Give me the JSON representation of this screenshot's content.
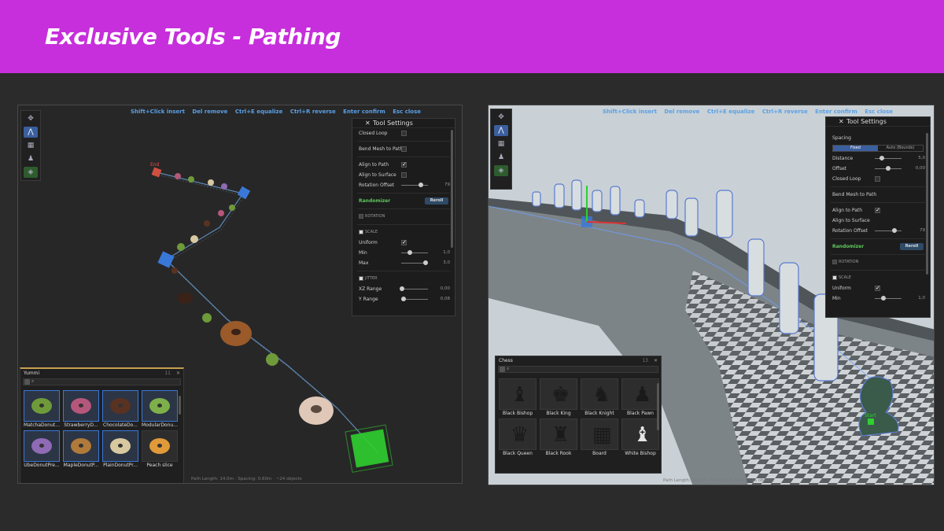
{
  "slide": {
    "title": "Exclusive Tools - Pathing"
  },
  "hotkeys": [
    "Shift+Click insert",
    "Del remove",
    "Ctrl+E equalize",
    "Ctrl+R reverse",
    "Enter confirm",
    "Esc close"
  ],
  "tool_icons": [
    "move-icon",
    "path-node-icon",
    "grid-icon",
    "stamp-icon",
    "scatter-icon"
  ],
  "left": {
    "viewport_labels": {
      "end": "End"
    },
    "settings": {
      "title": "Tool Settings",
      "closed_loop": "Closed Loop",
      "bend_mesh": "Bend Mesh to Path",
      "align_to_path": "Align to Path",
      "align_to_surface": "Align to Surface",
      "rotation_offset": "Rotation Offset",
      "rotation_offset_value": "79",
      "randomizer": "Randomizer",
      "reroll": "Reroll",
      "rotation_section": "ROTATION",
      "scale_section": "SCALE",
      "uniform": "Uniform",
      "min": "Min",
      "min_value": "1,0",
      "max": "Max",
      "max_value": "3,0",
      "jitter_section": "JITTER",
      "xz_range": "XZ Range",
      "xz_range_value": "0,00",
      "y_range": "Y Range",
      "y_range_value": "0,08"
    },
    "browser": {
      "title": "Yummi",
      "count": "11",
      "items": [
        {
          "label": "MatchaDonut...",
          "color": "#6f9a3a",
          "selected": true
        },
        {
          "label": "StrawberryD...",
          "color": "#b5577a",
          "selected": true
        },
        {
          "label": "ChocolateDo...",
          "color": "#5a3222",
          "selected": true
        },
        {
          "label": "ModularDonu...",
          "color": "#7db04a",
          "selected": true
        },
        {
          "label": "UbeDonutPre...",
          "color": "#8f6ab5",
          "selected": true
        },
        {
          "label": "MapleDonutP...",
          "color": "#b07a3a",
          "selected": true
        },
        {
          "label": "PlainDonutPr...",
          "color": "#d8c8a0",
          "selected": true
        },
        {
          "label": "Peach slice",
          "color": "#e09a3a",
          "selected": false
        }
      ]
    },
    "status": "Path Length: 14,0m  ·  Spacing: 0,60m  ·  ~24 objects"
  },
  "right": {
    "viewport_labels": {
      "start": "Start"
    },
    "settings": {
      "title": "Tool Settings",
      "spacing": "Spacing",
      "fixed": "Fixed",
      "auto_bounds": "Auto (Bounds)",
      "distance": "Distance",
      "distance_value": "5,0",
      "offset": "Offset",
      "offset_value": "0,00",
      "closed_loop": "Closed Loop",
      "bend_mesh": "Bend Mesh to Path",
      "align_to_path": "Align to Path",
      "align_to_surface": "Align to Surface",
      "rotation_offset": "Rotation Offset",
      "rotation_offset_value": "79",
      "randomizer": "Randomizer",
      "reroll": "Reroll",
      "rotation_section": "ROTATION",
      "scale_section": "SCALE",
      "uniform": "Uniform",
      "min": "Min",
      "min_value": "1,0"
    },
    "browser": {
      "title": "Chess",
      "count": "13",
      "items": [
        {
          "label": "Black Bishop",
          "glyph": "♝",
          "white": false
        },
        {
          "label": "Black King",
          "glyph": "♚",
          "white": false
        },
        {
          "label": "Black Knight",
          "glyph": "♞",
          "white": false
        },
        {
          "label": "Black Pawn",
          "glyph": "♟",
          "white": false
        },
        {
          "label": "Black Queen",
          "glyph": "♛",
          "white": false
        },
        {
          "label": "Black Rook",
          "glyph": "♜",
          "white": false
        },
        {
          "label": "Board",
          "glyph": "▦",
          "white": false
        },
        {
          "label": "White Bishop",
          "glyph": "♝",
          "white": true
        }
      ]
    },
    "status": "Path Length: 76,2m  ·  Spacing: 5,00m  ·  ~16 objects"
  }
}
